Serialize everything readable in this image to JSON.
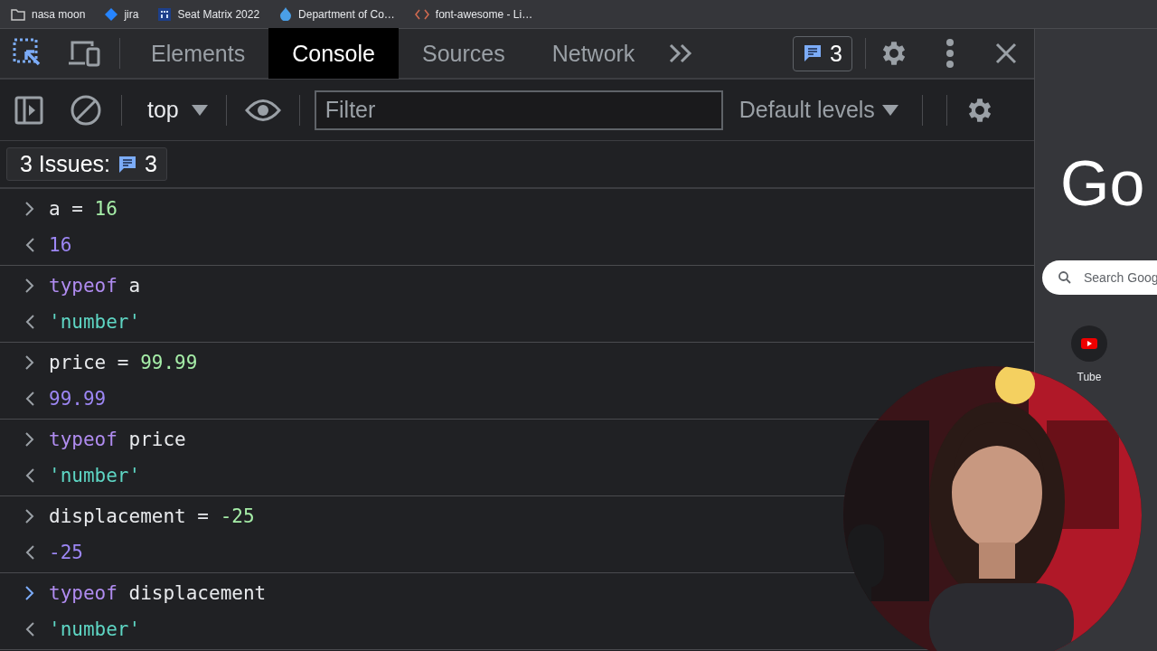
{
  "bookmarks": [
    {
      "label": "nasa moon",
      "kind": "folder"
    },
    {
      "label": "jira",
      "kind": "diamond"
    },
    {
      "label": "Seat Matrix 2022",
      "kind": "grid"
    },
    {
      "label": "Department of Co…",
      "kind": "drop"
    },
    {
      "label": "font-awesome - Li…",
      "kind": "code"
    }
  ],
  "tabs": [
    {
      "label": "Elements",
      "selected": false
    },
    {
      "label": "Console",
      "selected": true
    },
    {
      "label": "Sources",
      "selected": false
    },
    {
      "label": "Network",
      "selected": false
    }
  ],
  "issues_badge": "3",
  "toolbar": {
    "context": "top",
    "filter": {
      "placeholder": "Filter"
    },
    "levels": "Default levels"
  },
  "issues_bar": {
    "label": "3 Issues:",
    "count": "3"
  },
  "commands": [
    {
      "active": false,
      "input": [
        {
          "kind": "plain",
          "text": "a = "
        },
        {
          "kind": "number",
          "text": "16"
        }
      ],
      "output": [
        {
          "kind": "result",
          "text": "16"
        }
      ]
    },
    {
      "active": false,
      "input": [
        {
          "kind": "keyword",
          "text": "typeof"
        },
        {
          "kind": "plain",
          "text": " a"
        }
      ],
      "output": [
        {
          "kind": "string",
          "text": "'number'"
        }
      ]
    },
    {
      "active": false,
      "input": [
        {
          "kind": "plain",
          "text": "price = "
        },
        {
          "kind": "number",
          "text": "99.99"
        }
      ],
      "output": [
        {
          "kind": "result",
          "text": "99.99"
        }
      ]
    },
    {
      "active": false,
      "input": [
        {
          "kind": "keyword",
          "text": "typeof"
        },
        {
          "kind": "plain",
          "text": " price"
        }
      ],
      "output": [
        {
          "kind": "string",
          "text": "'number'"
        }
      ]
    },
    {
      "active": false,
      "input": [
        {
          "kind": "plain",
          "text": "displacement = "
        },
        {
          "kind": "number",
          "text": "-25"
        }
      ],
      "output": [
        {
          "kind": "result",
          "text": "-25"
        }
      ]
    },
    {
      "active": true,
      "input": [
        {
          "kind": "keyword",
          "text": "typeof"
        },
        {
          "kind": "plain",
          "text": " displacement"
        }
      ],
      "output": [
        {
          "kind": "string",
          "text": "'number'"
        }
      ]
    }
  ],
  "page": {
    "logo": "Go",
    "search": {
      "placeholder": "Search Goog"
    },
    "shortcuts": [
      {
        "label": "Tube"
      }
    ]
  }
}
